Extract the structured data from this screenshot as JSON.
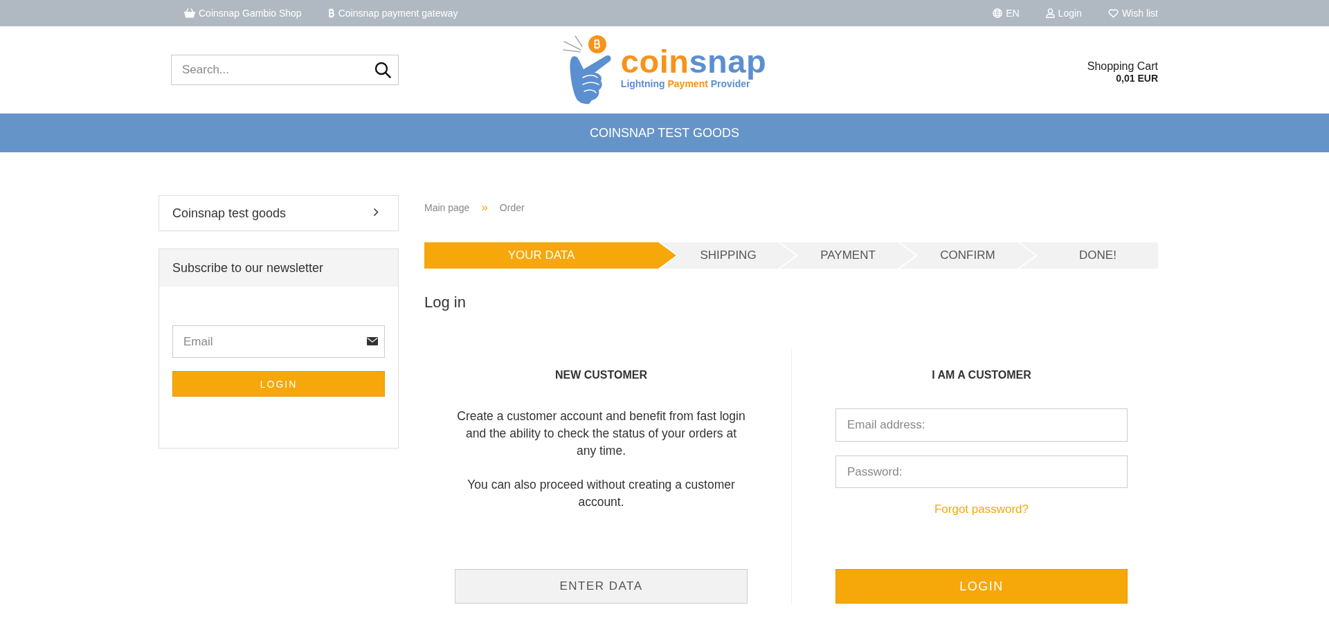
{
  "top_bar": {
    "shop_link": "Coinsnap Gambio Shop",
    "gateway_link": "Coinsnap payment gateway",
    "language": "EN",
    "login_link": "Login",
    "wishlist_link": "Wish list"
  },
  "header": {
    "search": {
      "placeholder": "Search..."
    },
    "logo": {
      "wordmark": [
        {
          "text": "coin",
          "color": "#f7931a"
        },
        {
          "text": "snap",
          "color": "#5b8fd0"
        }
      ],
      "tagline": [
        {
          "text": "Lightning",
          "color": "#5b8fd0"
        },
        {
          "text": "Payment",
          "color": "#f7931a"
        },
        {
          "text": "Provider",
          "color": "#5b8fd0"
        }
      ]
    },
    "cart": {
      "label": "Shopping Cart",
      "total": "0,01 EUR"
    }
  },
  "category_bar": {
    "title": "COINSNAP TEST GOODS"
  },
  "sidebar": {
    "category_link": "Coinsnap test goods",
    "newsletter": {
      "title": "Subscribe to our newsletter",
      "email_placeholder": "Email",
      "button": "LOGIN"
    }
  },
  "breadcrumb": {
    "items": [
      "Main page",
      "Order"
    ],
    "separator": "»"
  },
  "steps": [
    {
      "label": "YOUR DATA",
      "selected": true
    },
    {
      "label": "SHIPPING",
      "selected": false
    },
    {
      "label": "PAYMENT",
      "selected": false
    },
    {
      "label": "CONFIRM",
      "selected": false
    },
    {
      "label": "DONE!",
      "selected": false
    }
  ],
  "page_title": "Log in",
  "new_customer": {
    "title": "NEW CUSTOMER",
    "paragraphs": [
      "Create a customer account and benefit from fast login and the ability to check the status of your orders at any time.",
      "You can also proceed without creating a customer account."
    ],
    "button": "ENTER DATA"
  },
  "returning_customer": {
    "title": "I AM A CUSTOMER",
    "email_placeholder": "Email address:",
    "password_placeholder": "Password:",
    "forgot_link": "Forgot password?",
    "button": "LOGIN"
  }
}
